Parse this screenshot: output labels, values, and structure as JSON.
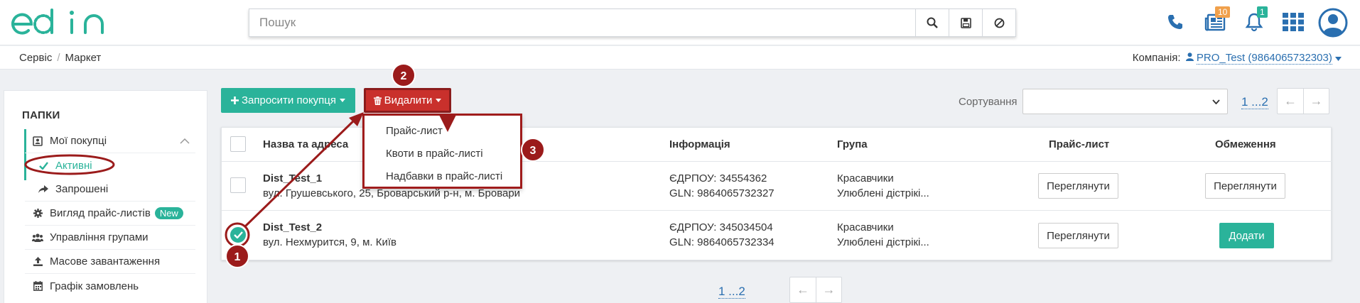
{
  "header": {
    "search_placeholder": "Пошук",
    "notif_catalog_count": "10",
    "notif_bell_count": "1"
  },
  "breadcrumb": [
    "Сервіс",
    "Маркет"
  ],
  "company": {
    "label": "Компанія:",
    "value": "PRO_Test (9864065732303)"
  },
  "sidebar": {
    "title": "ПАПКИ",
    "items": [
      {
        "label": "Мої покупці"
      },
      {
        "label": "Активні"
      },
      {
        "label": "Запрошені"
      },
      {
        "label": "Вигляд прайс-листів",
        "badge": "New"
      },
      {
        "label": "Управління групами"
      },
      {
        "label": "Масове завантаження"
      },
      {
        "label": "Графік замовлень"
      }
    ]
  },
  "toolbar": {
    "invite_label": "Запросити покупця",
    "delete_label": "Видалити",
    "sort_label": "Сортування",
    "pager": "1 ...2"
  },
  "dropdown": [
    "Прайс-лист",
    "Квоти в прайс-листі",
    "Надбавки в прайс-листі"
  ],
  "table": {
    "headers": [
      "Назва та адреса",
      "Інформація",
      "Група",
      "Прайс-лист",
      "Обмеження"
    ],
    "rows": [
      {
        "name": "Dist_Test_1",
        "address": "вул. Грушевського, 25, Броварський р-н, м. Бровари",
        "edrpou": "ЄДРПОУ: 34554362",
        "gln": "GLN: 9864065732327",
        "group1": "Красавчики",
        "group2": "Улюблені дістрікі...",
        "price_btn": "Переглянути",
        "limit_btn": "Переглянути"
      },
      {
        "name": "Dist_Test_2",
        "address": "вул. Нехмурится, 9, м. Київ",
        "edrpou": "ЄДРПОУ: 345034504",
        "gln": "GLN: 9864065732334",
        "group1": "Красавчики",
        "group2": "Улюблені дістрікі...",
        "price_btn": "Переглянути",
        "limit_btn": "Додати"
      }
    ]
  },
  "bottom_pager": "1 ...2",
  "annotations": [
    "1",
    "2",
    "3"
  ],
  "colors": {
    "brand": "#2ab39a",
    "danger": "#c9302c",
    "annotation": "#9b1b1b",
    "link": "#2a6fb0"
  }
}
